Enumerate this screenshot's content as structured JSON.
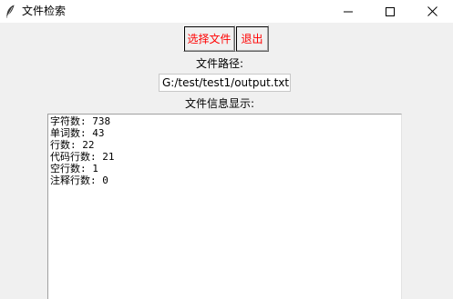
{
  "window": {
    "title": "文件检索",
    "icon": "feather-icon"
  },
  "titlebar": {
    "minimize_icon": "minimize-icon",
    "maximize_icon": "maximize-icon",
    "close_icon": "close-icon"
  },
  "toolbar": {
    "select_file_label": "选择文件",
    "exit_label": "退出",
    "button_text_color": "#ff0000"
  },
  "file_path": {
    "label": "文件路径:",
    "value": "G:/test/test1/output.txt"
  },
  "file_info": {
    "label": "文件信息显示:",
    "lines": [
      "字符数: 738",
      "单词数: 43",
      "行数: 22",
      "代码行数: 21",
      "空行数: 1",
      "注释行数: 0"
    ]
  }
}
